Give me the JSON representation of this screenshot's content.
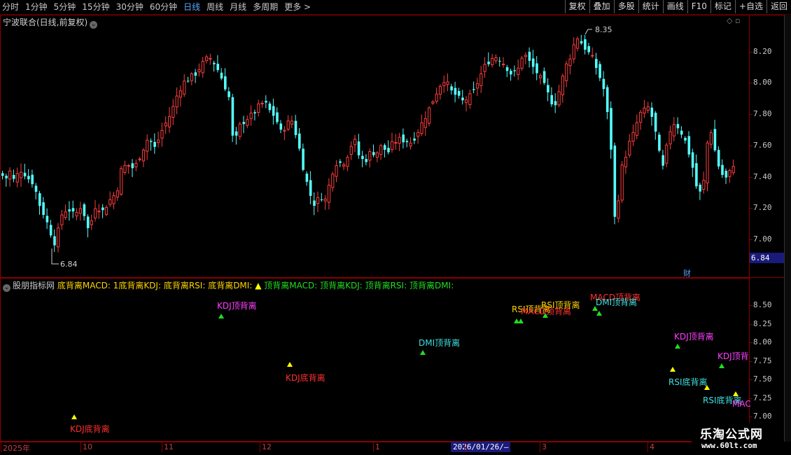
{
  "periods": [
    {
      "label": "分时"
    },
    {
      "label": "1分钟"
    },
    {
      "label": "5分钟"
    },
    {
      "label": "15分钟"
    },
    {
      "label": "30分钟"
    },
    {
      "label": "60分钟"
    },
    {
      "label": "日线",
      "active": true
    },
    {
      "label": "周线"
    },
    {
      "label": "月线"
    },
    {
      "label": "多周期"
    },
    {
      "label": "更多 >"
    }
  ],
  "tools": [
    "复权",
    "叠加",
    "多股",
    "统计",
    "画线",
    "F10",
    "标记",
    "+自选",
    "返回"
  ],
  "stock_title": "宁波联合(日线,前复权)",
  "price_axis": {
    "ticks": [
      "8.20",
      "8.00",
      "7.80",
      "7.60",
      "7.40",
      "7.20",
      "7.00"
    ],
    "current": "6.84"
  },
  "price_annotations": {
    "high": "8.35",
    "low": "6.84"
  },
  "cai_badge": "财",
  "indicator": {
    "name": "股朋指标网",
    "header_segments": [
      {
        "text": "底背离MACD: 1",
        "color": "#ffd400"
      },
      {
        "text": "底背离KDJ: ",
        "color": "#ffd400"
      },
      {
        "text": "底背离RSI: ",
        "color": "#ffd400"
      },
      {
        "text": "底背离DMI: ",
        "color": "#ffd400"
      },
      {
        "text": "▲",
        "color": "#ffff00"
      },
      {
        "text": " 顶背离MACD: ",
        "color": "#22dd22"
      },
      {
        "text": "顶背离KDJ: ",
        "color": "#22dd22"
      },
      {
        "text": "顶背离RSI: ",
        "color": "#22dd22"
      },
      {
        "text": "顶背离DMI:",
        "color": "#22dd22"
      }
    ],
    "axis_ticks": [
      "8.50",
      "8.25",
      "8.00",
      "7.75",
      "7.50",
      "7.25",
      "7.00"
    ],
    "signals": [
      {
        "text": "KDJ底背离",
        "color": "#ff3030"
      },
      {
        "text": "KDJ顶背离",
        "color": "#ff40ff"
      },
      {
        "text": "KDJ底背离",
        "color": "#ff3030"
      },
      {
        "text": "DMI顶背离",
        "color": "#40e0e0"
      },
      {
        "text": "RSI顶背离",
        "color": "#ffd400"
      },
      {
        "text": "MACD顶背离",
        "color": "#ff3030"
      },
      {
        "text": "RSI顶背离",
        "color": "#ffd400"
      },
      {
        "text": "MACD顶背离",
        "color": "#ff3030"
      },
      {
        "text": "DMI顶背离",
        "color": "#40e0e0"
      },
      {
        "text": "KDJ顶背离",
        "color": "#ff40ff"
      },
      {
        "text": "RSI底背离",
        "color": "#40e0e0"
      },
      {
        "text": "KDJ顶背",
        "color": "#ff40ff"
      },
      {
        "text": "RSI底背离",
        "color": "#40e0e0"
      },
      {
        "text": "MAC",
        "color": "#ff40ff"
      }
    ]
  },
  "date_axis": {
    "labels": [
      "2025年",
      "10",
      "11",
      "12",
      "1",
      "2",
      "3",
      "4"
    ],
    "crosshair": "2026/01/26/—"
  },
  "watermark": {
    "title": "乐淘公式网",
    "url": "www.60lt.com"
  },
  "colors": {
    "up": "#ff3c3c",
    "down": "#54ffff",
    "frame": "#8a0000",
    "signal_bottom": "#ffff00",
    "signal_top": "#22dd22"
  }
}
